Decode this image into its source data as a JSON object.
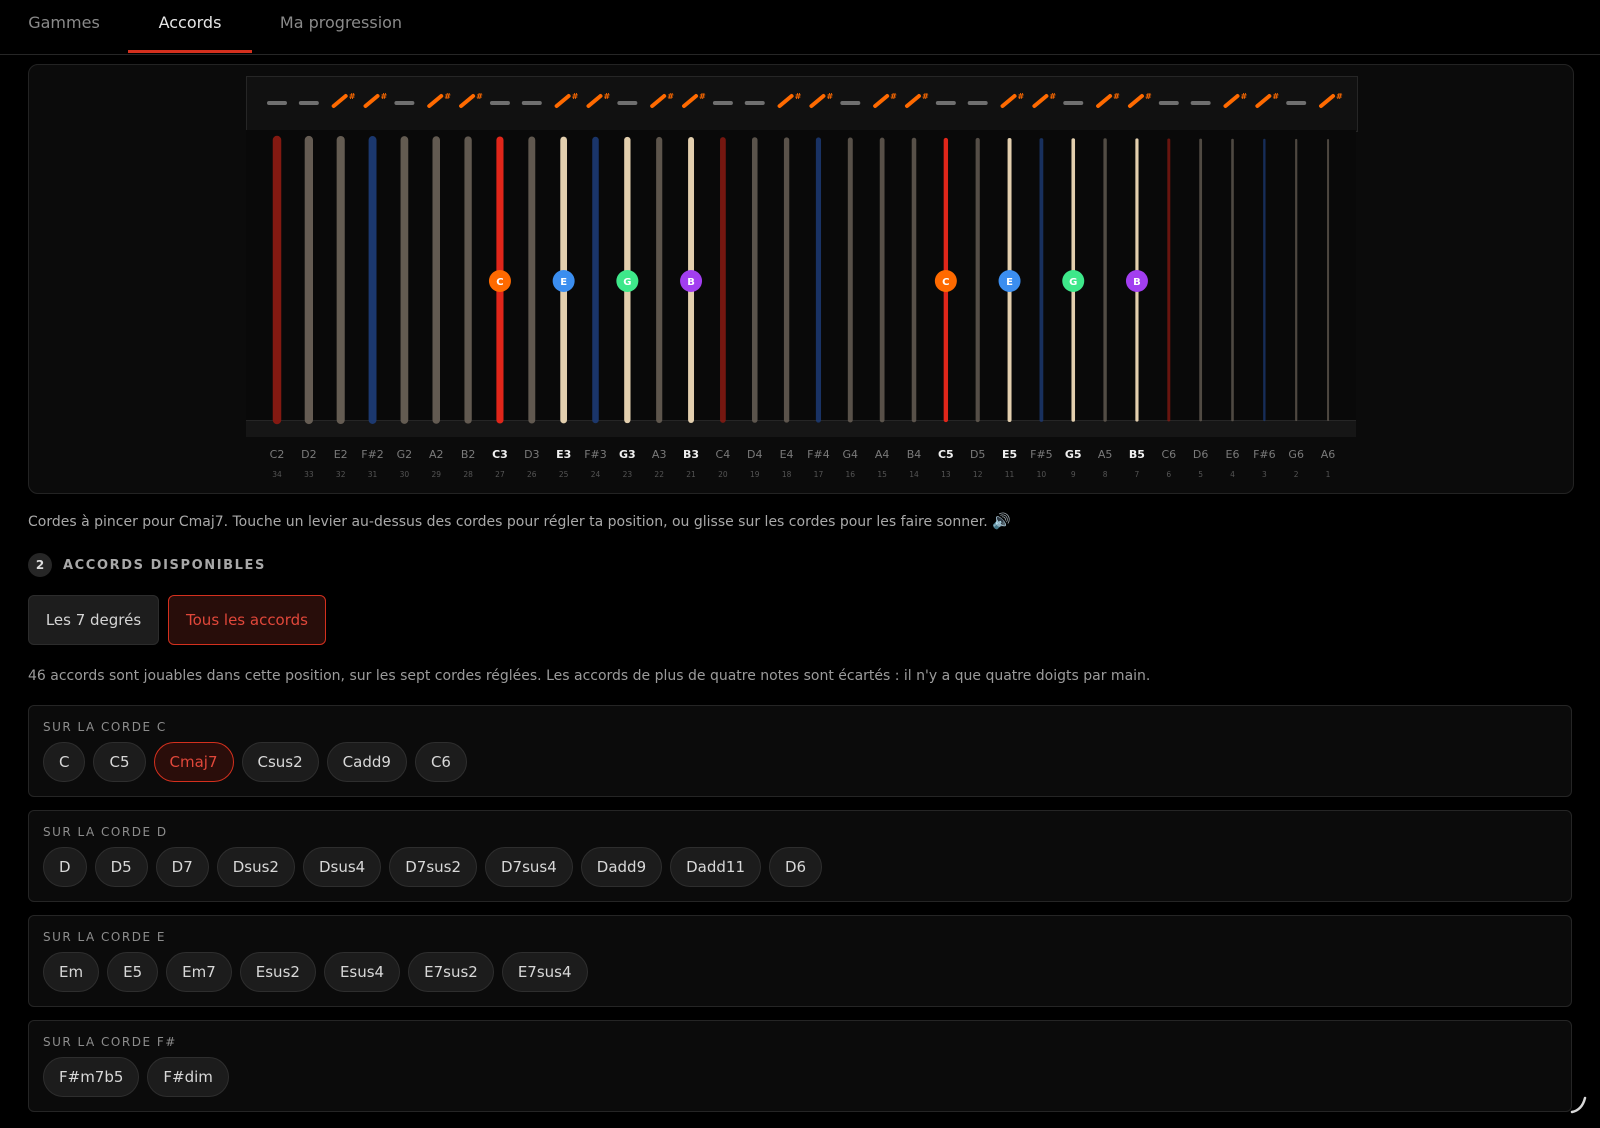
{
  "tabs": [
    "Gammes",
    "Accords",
    "Ma progression"
  ],
  "active_tab": 1,
  "harp": {
    "levers": [
      "flat",
      "flat",
      "sharp",
      "sharp",
      "flat",
      "sharp",
      "sharp",
      "flat",
      "flat",
      "sharp",
      "sharp",
      "flat",
      "sharp",
      "sharp",
      "flat",
      "flat",
      "sharp",
      "sharp",
      "flat",
      "sharp",
      "sharp",
      "flat",
      "flat",
      "sharp",
      "sharp",
      "flat",
      "sharp",
      "sharp",
      "flat",
      "flat",
      "sharp",
      "sharp",
      "flat",
      "sharp"
    ],
    "strings": [
      {
        "note": "C2",
        "num": "34",
        "kind": "red"
      },
      {
        "note": "D2",
        "num": "33",
        "kind": "plain"
      },
      {
        "note": "E2",
        "num": "32",
        "kind": "plain"
      },
      {
        "note": "F#2",
        "num": "31",
        "kind": "blue"
      },
      {
        "note": "G2",
        "num": "30",
        "kind": "plain"
      },
      {
        "note": "A2",
        "num": "29",
        "kind": "plain"
      },
      {
        "note": "B2",
        "num": "28",
        "kind": "plain"
      },
      {
        "note": "C3",
        "num": "27",
        "kind": "red",
        "active": true,
        "dot": "C"
      },
      {
        "note": "D3",
        "num": "26",
        "kind": "plain"
      },
      {
        "note": "E3",
        "num": "25",
        "kind": "plain",
        "active": true,
        "dot": "E"
      },
      {
        "note": "F#3",
        "num": "24",
        "kind": "blue"
      },
      {
        "note": "G3",
        "num": "23",
        "kind": "plain",
        "active": true,
        "dot": "G"
      },
      {
        "note": "A3",
        "num": "22",
        "kind": "plain"
      },
      {
        "note": "B3",
        "num": "21",
        "kind": "plain",
        "active": true,
        "dot": "B"
      },
      {
        "note": "C4",
        "num": "20",
        "kind": "red"
      },
      {
        "note": "D4",
        "num": "19",
        "kind": "plain"
      },
      {
        "note": "E4",
        "num": "18",
        "kind": "plain"
      },
      {
        "note": "F#4",
        "num": "17",
        "kind": "blue"
      },
      {
        "note": "G4",
        "num": "16",
        "kind": "plain"
      },
      {
        "note": "A4",
        "num": "15",
        "kind": "plain"
      },
      {
        "note": "B4",
        "num": "14",
        "kind": "plain"
      },
      {
        "note": "C5",
        "num": "13",
        "kind": "red",
        "active": true,
        "dot": "C"
      },
      {
        "note": "D5",
        "num": "12",
        "kind": "plain"
      },
      {
        "note": "E5",
        "num": "11",
        "kind": "plain",
        "active": true,
        "dot": "E"
      },
      {
        "note": "F#5",
        "num": "10",
        "kind": "blue"
      },
      {
        "note": "G5",
        "num": "9",
        "kind": "plain",
        "active": true,
        "dot": "G"
      },
      {
        "note": "A5",
        "num": "8",
        "kind": "plain"
      },
      {
        "note": "B5",
        "num": "7",
        "kind": "plain",
        "active": true,
        "dot": "B"
      },
      {
        "note": "C6",
        "num": "6",
        "kind": "red"
      },
      {
        "note": "D6",
        "num": "5",
        "kind": "plain"
      },
      {
        "note": "E6",
        "num": "4",
        "kind": "plain"
      },
      {
        "note": "F#6",
        "num": "3",
        "kind": "blue"
      },
      {
        "note": "G6",
        "num": "2",
        "kind": "plain"
      },
      {
        "note": "A6",
        "num": "1",
        "kind": "plain"
      }
    ],
    "dot_colors": {
      "C": "#ff6a00",
      "E": "#3b8ef0",
      "G": "#3ee88a",
      "B": "#a23ef0"
    },
    "lever_color": "#ff6a00",
    "string_colors": {
      "red": "#8a1a12",
      "red_active": "#e0261a",
      "blue": "#1d3c78",
      "plain": "#6b6258",
      "plain_active": "#e3cfae"
    }
  },
  "caption": "Cordes à pincer pour Cmaj7. Touche un levier au-dessus des cordes pour régler ta position, ou glisse sur les cordes pour les faire sonner.",
  "caption_icon": "speaker-icon",
  "section": {
    "step": "2",
    "title": "ACCORDS DISPONIBLES"
  },
  "filters": {
    "degrees": "Les 7 degrés",
    "all": "Tous les accords"
  },
  "count_text": "46 accords sont jouables dans cette position, sur les sept cordes réglées. Les accords de plus de quatre notes sont écartés : il n'y a que quatre doigts par main.",
  "groups": [
    {
      "title": "SUR LA CORDE C",
      "chords": [
        "C",
        "C5",
        "Cmaj7",
        "Csus2",
        "Cadd9",
        "C6"
      ],
      "selected": "Cmaj7"
    },
    {
      "title": "SUR LA CORDE D",
      "chords": [
        "D",
        "D5",
        "D7",
        "Dsus2",
        "Dsus4",
        "D7sus2",
        "D7sus4",
        "Dadd9",
        "Dadd11",
        "D6"
      ]
    },
    {
      "title": "SUR LA CORDE E",
      "chords": [
        "Em",
        "E5",
        "Em7",
        "Esus2",
        "Esus4",
        "E7sus2",
        "E7sus4"
      ]
    },
    {
      "title": "SUR LA CORDE F#",
      "chords": [
        "F#m7b5",
        "F#dim"
      ]
    }
  ],
  "accent": "#d4301e"
}
